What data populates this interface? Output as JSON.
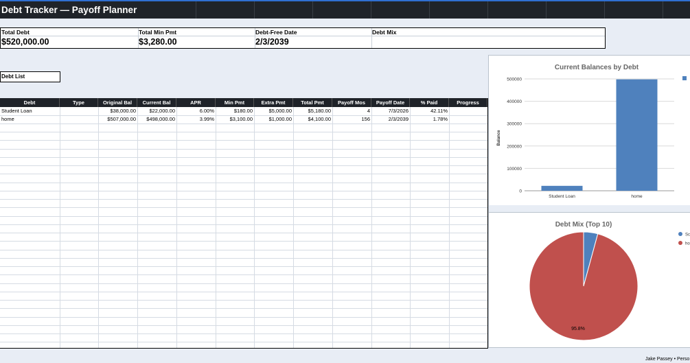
{
  "title": "Debt Tracker — Payoff Planner",
  "summary": [
    {
      "label": "Total Debt",
      "value": "$520,000.00"
    },
    {
      "label": "Total Min Pmt",
      "value": "$3,280.00"
    },
    {
      "label": "Debt-Free Date",
      "value": "2/3/2039"
    },
    {
      "label": "Debt Mix",
      "value": ""
    }
  ],
  "section_label": "Debt List",
  "table": {
    "headers": [
      "Debt",
      "Type",
      "Original Bal",
      "Current Bal",
      "APR",
      "Min Pmt",
      "Extra Pmt",
      "Total Pmt",
      "Payoff Mos",
      "Payoff Date",
      "% Paid",
      "Progress"
    ],
    "rows": [
      [
        "Student Loan",
        "",
        "$38,000.00",
        "$22,000.00",
        "6.00%",
        "$180.00",
        "$5,000.00",
        "$5,180.00",
        "4",
        "7/3/2026",
        "42.11%",
        ""
      ],
      [
        "home",
        "",
        "$507,000.00",
        "$498,000.00",
        "3.99%",
        "$3,100.00",
        "$1,000.00",
        "$4,100.00",
        "156",
        "2/3/2039",
        "1.78%",
        ""
      ]
    ]
  },
  "colors": {
    "bar": "#4f81bd",
    "pie_a": "#4f81bd",
    "pie_b": "#c0504d",
    "header": "#1f2329"
  },
  "chart_data": [
    {
      "type": "bar",
      "title": "Current Balances by Debt",
      "categories": [
        "Student Loan",
        "home"
      ],
      "values": [
        22000,
        498000
      ],
      "ylabel": "Balance",
      "ylim": [
        0,
        500000
      ],
      "yticks": [
        "0",
        "100000",
        "200000",
        "300000",
        "400000",
        "500000"
      ],
      "grid": true,
      "legend": "top-right"
    },
    {
      "type": "pie",
      "title": "Debt Mix (Top 10)",
      "categories": [
        "Sc",
        "ho"
      ],
      "values": [
        22000,
        498000
      ],
      "data_labels": [
        "",
        "95.8%"
      ],
      "legend": "right"
    }
  ],
  "footer": "Jake Passey • Perso"
}
